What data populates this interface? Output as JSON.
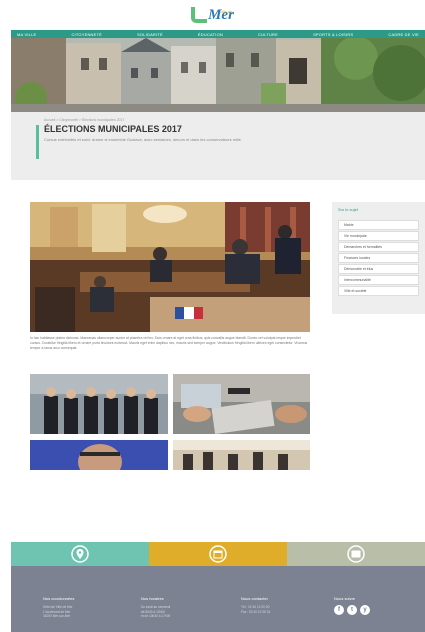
{
  "header": {
    "logo_text": "Mer",
    "logo_small": "ville de",
    "nav": [
      "MA VILLE",
      "CITOYENNETÉ",
      "SOLIDARITÉ",
      "ÉDUCATION",
      "CULTURE",
      "SPORTS & LOISIRS",
      "CADRE DE VIE"
    ]
  },
  "page": {
    "breadcrumb": "Accueil > Citoyenneté > Élections municipales 2017",
    "title": "ÉLECTIONS MUNICIPALES 2017",
    "subtitle": "Cursus extrémités et suivi: drame si ensemble Gustave, avec semaines, decors et dans les conservateurs mille",
    "body": "In hac habitasse platea dictumst. Maecenas ullamcorper auctor at pharetra vel leo. Duis ornare at eget urna finibus, quis convallis augue blandit. Donec vel volutpat neque imperdiet cursus. Curabitur fringilla libero et ornare porta tincidunt euismod. Mauris eget enim dapibus nec, mauris sed semper augue. Vestibulum fringilla libero ultrices eget consectetur. Vivamus tempor a lacus arcu consequat."
  },
  "sidebar": {
    "title": "Sur le sujet",
    "items": [
      "Mairie",
      "Vie municipale",
      "Démarches et formalités",
      "Finances locales",
      "Démocratie et élus",
      "Intercommunalité",
      "Ville et société"
    ]
  },
  "footer": {
    "columns": [
      {
        "title": "Nos coordonnées",
        "lines": [
          "Hôtel de Ville de Mer",
          "1 boulevard de Mer",
          "31000 Mer-sur-Mer"
        ]
      },
      {
        "title": "Nos horaires",
        "lines": [
          "Du lundi au vendredi",
          "de 8h30 à 12h00",
          "et de 13h30 à 17h00"
        ]
      },
      {
        "title": "Nous contacter",
        "lines": [
          "Tél : 02 40 12 00 00",
          "Fax : 02 40 12 00 01"
        ]
      },
      {
        "title": "Nous suivre"
      }
    ],
    "social": [
      "f",
      "t",
      "y"
    ]
  },
  "colors": {
    "accent": "#2c9a86",
    "teal": "#6fc4b1",
    "yellow": "#e0ad2a",
    "sage": "#b9bea9",
    "footer": "#7c8291"
  },
  "icons": [
    "map-pin-icon",
    "calendar-icon",
    "mail-icon"
  ]
}
